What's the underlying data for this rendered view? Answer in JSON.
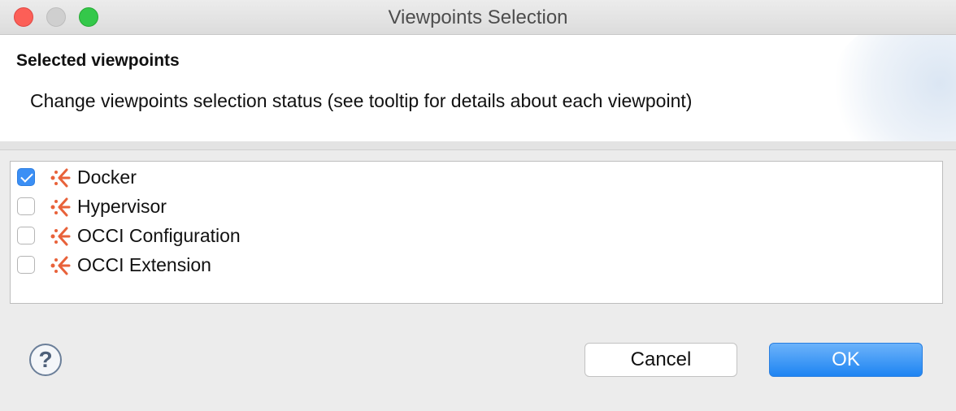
{
  "window": {
    "title": "Viewpoints Selection"
  },
  "banner": {
    "heading": "Selected viewpoints",
    "description": "Change viewpoints selection status (see tooltip for details about each viewpoint)"
  },
  "viewpoints": [
    {
      "label": "Docker",
      "checked": true,
      "icon": "viewpoint-icon"
    },
    {
      "label": "Hypervisor",
      "checked": false,
      "icon": "viewpoint-icon"
    },
    {
      "label": "OCCI Configuration",
      "checked": false,
      "icon": "viewpoint-icon"
    },
    {
      "label": "OCCI Extension",
      "checked": false,
      "icon": "viewpoint-icon"
    }
  ],
  "buttons": {
    "help_glyph": "?",
    "cancel": "Cancel",
    "ok": "OK"
  },
  "colors": {
    "accent": "#3b8ff5",
    "viewpoint_icon": "#e8623a",
    "close": "#fc5f57",
    "maximize": "#34c84a"
  }
}
